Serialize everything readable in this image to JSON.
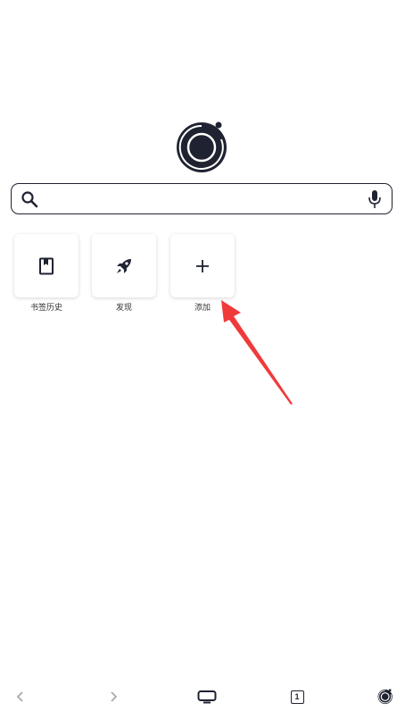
{
  "search": {
    "value": "",
    "placeholder": ""
  },
  "shortcuts": [
    {
      "label": "书签历史",
      "icon": "bookmark-icon"
    },
    {
      "label": "发现",
      "icon": "rocket-icon"
    },
    {
      "label": "添加",
      "icon": "plus-icon"
    }
  ],
  "bottom_bar": {
    "tab_count": "1",
    "icons": [
      "back-icon",
      "forward-icon",
      "tv-icon",
      "tabs-icon",
      "app-logo-icon"
    ]
  },
  "colors": {
    "dark": "#1f2230",
    "arrow": "#f03a3a",
    "disabled": "#aaaaaa"
  }
}
